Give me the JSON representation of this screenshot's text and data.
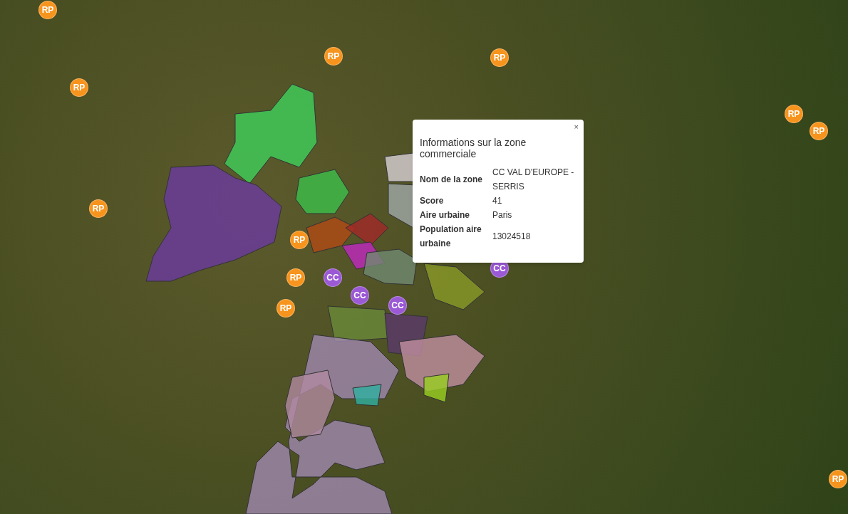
{
  "map": {
    "markers": [
      {
        "kind": "rp",
        "label": "RP"
      },
      {
        "kind": "rp",
        "label": "RP"
      },
      {
        "kind": "rp",
        "label": "RP"
      },
      {
        "kind": "rp",
        "label": "RP"
      },
      {
        "kind": "rp",
        "label": "RP"
      },
      {
        "kind": "rp",
        "label": "RP"
      },
      {
        "kind": "rp",
        "label": "RP"
      },
      {
        "kind": "rp",
        "label": "RP"
      },
      {
        "kind": "rp",
        "label": "RP"
      },
      {
        "kind": "rp",
        "label": "RP"
      },
      {
        "kind": "rp",
        "label": "RP"
      },
      {
        "kind": "cc",
        "label": "CC"
      },
      {
        "kind": "cc",
        "label": "CC"
      },
      {
        "kind": "cc",
        "label": "CC"
      },
      {
        "kind": "cc",
        "label": "CC"
      }
    ]
  },
  "popup": {
    "close": "×",
    "title": "Informations sur la zone commerciale",
    "rows": [
      {
        "label": "Nom de la zone",
        "value": "CC VAL D'EUROPE - SERRIS"
      },
      {
        "label": "Score",
        "value": "41"
      },
      {
        "label": "Aire urbaine",
        "value": "Paris"
      },
      {
        "label": "Population aire urbaine",
        "value": "13024518"
      }
    ]
  }
}
